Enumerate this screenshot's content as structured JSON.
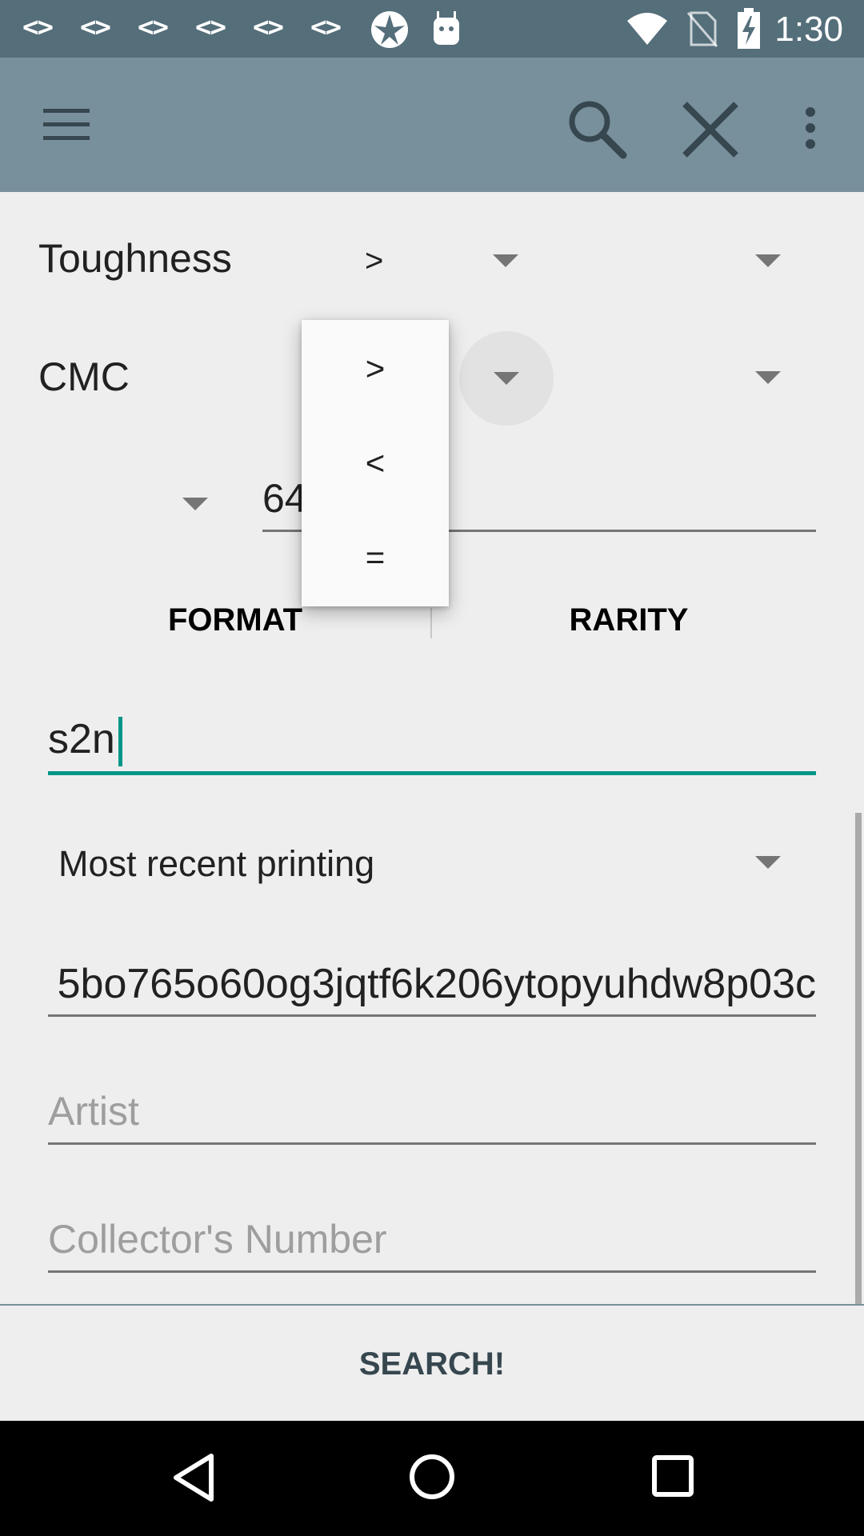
{
  "status_bar": {
    "notification_icons": [
      "code-icon",
      "code-icon",
      "code-icon",
      "code-icon",
      "code-icon",
      "code-icon",
      "app-icon",
      "android-icon"
    ],
    "time": "1:30"
  },
  "toolbar": {
    "menu_icon": "hamburger-menu-icon",
    "search_icon": "search-icon",
    "close_icon": "close-icon",
    "overflow_icon": "more-vert-icon"
  },
  "toughness": {
    "label": "Toughness",
    "operator": ">",
    "value": ""
  },
  "cmc": {
    "label": "CMC",
    "value": ""
  },
  "partial_row": {
    "text": "64"
  },
  "operator_popup": {
    "options": [
      ">",
      "<",
      "="
    ]
  },
  "tabs": {
    "format_label": "FORMAT",
    "rarity_label": "RARITY"
  },
  "set_field": {
    "value": "s2n"
  },
  "printing": {
    "selected": "Most recent printing"
  },
  "long_field": {
    "value": "5bo765o60og3jqtf6k206ytopyuhdw8p03c"
  },
  "artist_field": {
    "placeholder": "Artist"
  },
  "collector_field": {
    "placeholder": "Collector's Number"
  },
  "search_button": {
    "label": "SEARCH!"
  },
  "colors": {
    "status_bar": "#546e7a",
    "toolbar": "#78909c",
    "accent": "#009688"
  }
}
